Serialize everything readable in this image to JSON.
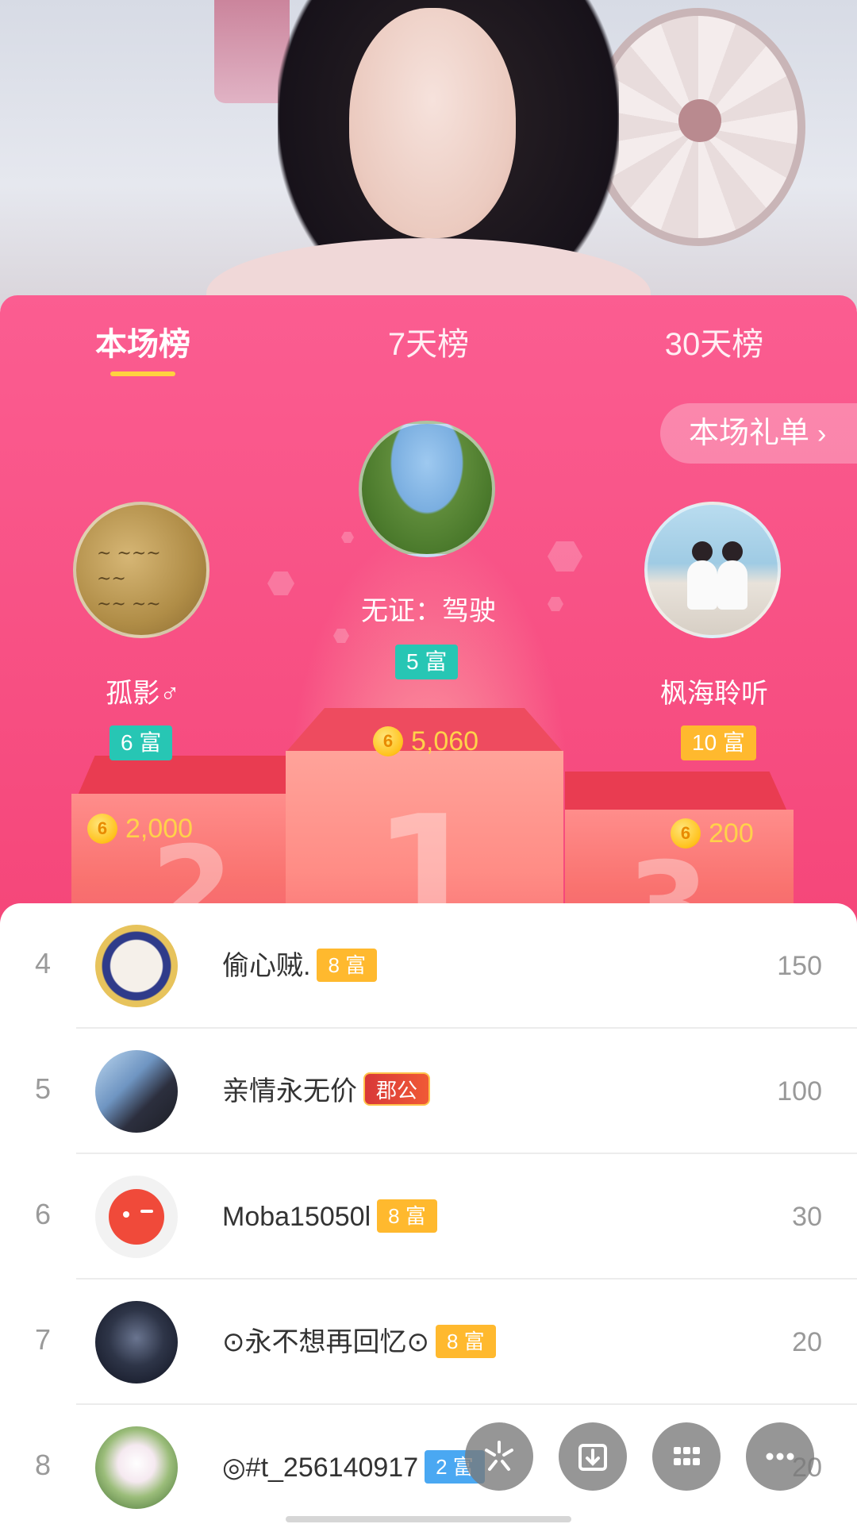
{
  "tabs": [
    {
      "label": "本场榜",
      "active": true
    },
    {
      "label": "7天榜",
      "active": false
    },
    {
      "label": "30天榜",
      "active": false
    }
  ],
  "gift_list_button": {
    "label": "本场礼单",
    "icon": "chevron-right-icon"
  },
  "podium": {
    "first": {
      "rank": "1",
      "name": "无证：驾驶",
      "wealth": "5 富",
      "score": "5,060",
      "avatar": "field-photo"
    },
    "second": {
      "rank": "2",
      "name": "孤影♂",
      "wealth": "6 富",
      "score": "2,000",
      "avatar": "handwriting-photo"
    },
    "third": {
      "rank": "3",
      "name": "枫海聆听",
      "wealth": "10 富",
      "score": "200",
      "avatar": "couple-beach-photo"
    }
  },
  "coin_glyph": "6",
  "list": [
    {
      "rank": "4",
      "name": "偷心贼.",
      "badge": "8 富",
      "badge_type": "wealth",
      "value": "150"
    },
    {
      "rank": "5",
      "name": "亲情永无价",
      "badge": "郡公",
      "badge_type": "noble",
      "value": "100"
    },
    {
      "rank": "6",
      "name": "Moba15050l",
      "badge": "8 富",
      "badge_type": "wealth",
      "value": "30"
    },
    {
      "rank": "7",
      "name": "⊙永不想再回忆⊙",
      "badge": "8 富",
      "badge_type": "wealth",
      "value": "20"
    },
    {
      "rank": "8",
      "name": "◎#t_256140917",
      "badge": "2 富",
      "badge_type": "wealth",
      "value": "20"
    }
  ],
  "fabs": [
    "share-icon",
    "download-icon",
    "grid-icon",
    "more-icon"
  ],
  "colors": {
    "accent": "#f5477a",
    "tab_underline": "#ffd23f",
    "wealth_teal": "#27c6b4",
    "wealth_gold": "#ffb92e",
    "score_gold": "#ffd24a"
  }
}
